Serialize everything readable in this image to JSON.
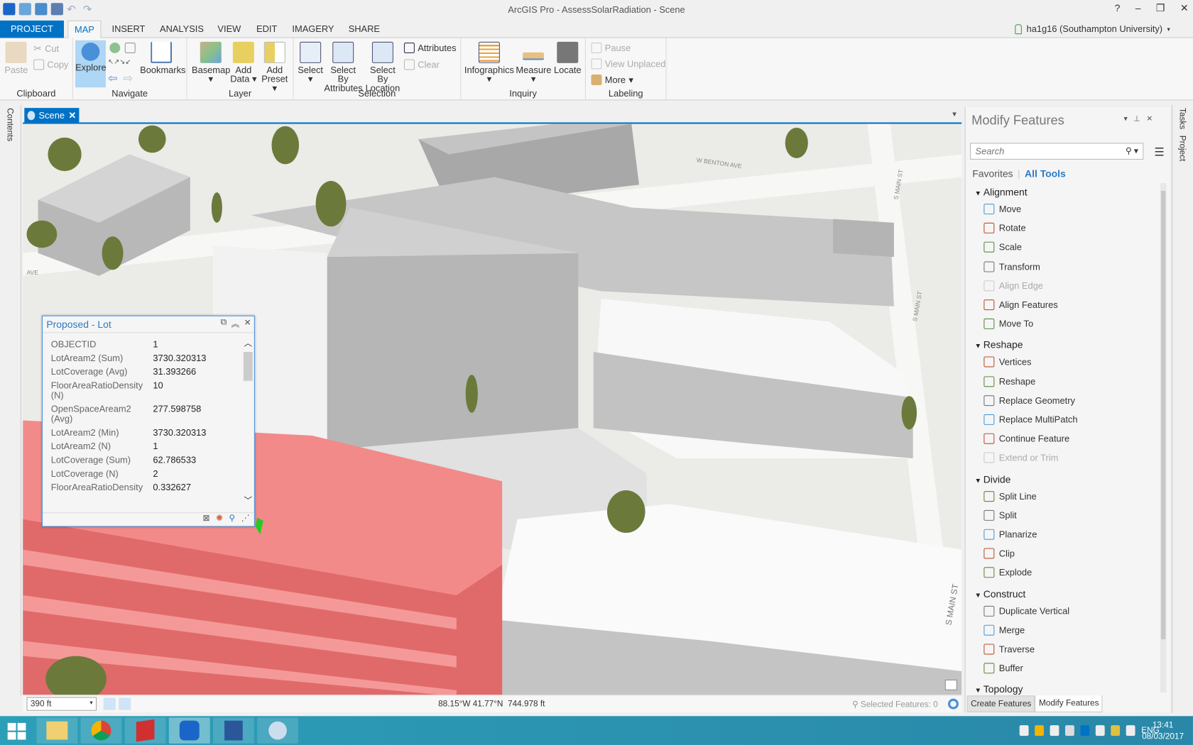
{
  "window": {
    "title": "ArcGIS Pro - AssessSolarRadiation - Scene",
    "controls": [
      "?",
      "–",
      "❐",
      "✕"
    ]
  },
  "user": {
    "name": "ha1g16 (Southampton University)"
  },
  "tabs": [
    "PROJECT",
    "MAP",
    "INSERT",
    "ANALYSIS",
    "VIEW",
    "EDIT",
    "IMAGERY",
    "SHARE"
  ],
  "active_tab": "MAP",
  "ribbon": {
    "clipboard": {
      "label": "Clipboard",
      "paste": "Paste",
      "cut": "Cut",
      "copy": "Copy"
    },
    "navigate": {
      "label": "Navigate",
      "explore": "Explore",
      "bookmarks": "Bookmarks"
    },
    "layer": {
      "label": "Layer",
      "basemap": "Basemap",
      "add_data": "Add Data",
      "add_preset": "Add Preset"
    },
    "selection": {
      "label": "Selection",
      "select": "Select",
      "select_by_attributes": "Select By Attributes",
      "select_by_location": "Select By Location",
      "attributes": "Attributes",
      "clear": "Clear"
    },
    "inquiry": {
      "label": "Inquiry",
      "infographics": "Infographics",
      "measure": "Measure",
      "locate": "Locate"
    },
    "labeling": {
      "label": "Labeling",
      "pause": "Pause",
      "view_unplaced": "View Unplaced",
      "more": "More"
    }
  },
  "left_strip": "Contents",
  "view_tab": "Scene",
  "map_labels": [
    "W BENTON AVE",
    "S MAIN ST",
    "S MAIN ST",
    "S MAIN ST",
    "AVE"
  ],
  "popup": {
    "title": "Proposed - Lot",
    "rows": [
      {
        "k": "OBJECTID",
        "v": "1"
      },
      {
        "k": "LotAream2 (Sum)",
        "v": "3730.320313"
      },
      {
        "k": "LotCoverage (Avg)",
        "v": "31.393266"
      },
      {
        "k": "FloorAreaRatioDensity (N)",
        "v": "10"
      },
      {
        "k": "OpenSpaceAream2 (Avg)",
        "v": "277.598758"
      },
      {
        "k": "LotAream2 (Min)",
        "v": "3730.320313"
      },
      {
        "k": "LotAream2 (N)",
        "v": "1"
      },
      {
        "k": "LotCoverage (Sum)",
        "v": "62.786533"
      },
      {
        "k": "LotCoverage (N)",
        "v": "2"
      },
      {
        "k": "FloorAreaRatioDensity",
        "v": "0.332627"
      }
    ]
  },
  "status": {
    "scale": "390 ft",
    "coords": "88.15°W 41.77°N",
    "elevation": "744.978 ft",
    "selected": "Selected Features: 0"
  },
  "panel": {
    "title": "Modify Features",
    "search_placeholder": "Search",
    "favorites": "Favorites",
    "all_tools": "All Tools",
    "sections": [
      {
        "name": "Alignment",
        "tools": [
          {
            "n": "Move"
          },
          {
            "n": "Rotate"
          },
          {
            "n": "Scale"
          },
          {
            "n": "Transform"
          },
          {
            "n": "Align Edge",
            "disabled": true
          },
          {
            "n": "Align Features"
          },
          {
            "n": "Move To"
          }
        ]
      },
      {
        "name": "Reshape",
        "tools": [
          {
            "n": "Vertices"
          },
          {
            "n": "Reshape"
          },
          {
            "n": "Replace Geometry"
          },
          {
            "n": "Replace MultiPatch"
          },
          {
            "n": "Continue Feature"
          },
          {
            "n": "Extend or Trim",
            "disabled": true
          }
        ]
      },
      {
        "name": "Divide",
        "tools": [
          {
            "n": "Split Line"
          },
          {
            "n": "Split"
          },
          {
            "n": "Planarize"
          },
          {
            "n": "Clip"
          },
          {
            "n": "Explode"
          }
        ]
      },
      {
        "name": "Construct",
        "tools": [
          {
            "n": "Duplicate Vertical"
          },
          {
            "n": "Merge"
          },
          {
            "n": "Traverse"
          },
          {
            "n": "Buffer"
          }
        ]
      },
      {
        "name": "Topology",
        "tools": []
      }
    ],
    "bottom_tabs": [
      "Create Features",
      "Modify Features"
    ],
    "active_bottom_tab": "Modify Features"
  },
  "right_strip": [
    "Tasks",
    "Project"
  ],
  "taskbar": {
    "lang": "ENG",
    "time": "13:41",
    "date": "08/03/2017"
  },
  "colors": {
    "accent": "#0072c6",
    "proposed_lot": "#f08080",
    "building": "#c8c8c8"
  }
}
